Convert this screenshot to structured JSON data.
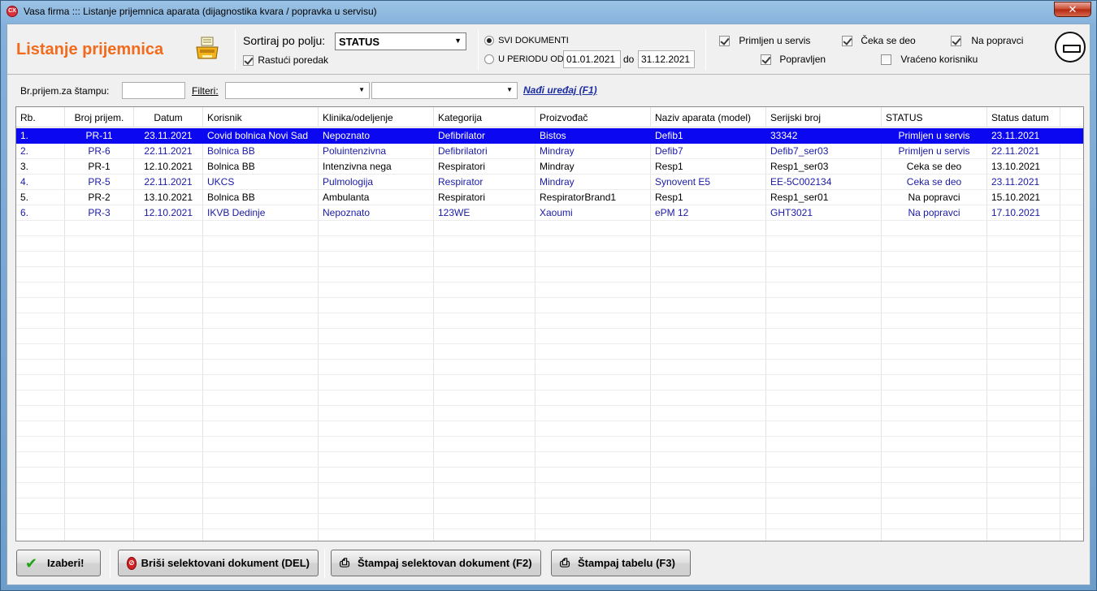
{
  "window": {
    "app_icon": "CX",
    "title": "Vasa firma ::: Listanje prijemnica aparata (dijagnostika kvara / popravka u servisu)",
    "close_label": "✕"
  },
  "header": {
    "page_title": "Listanje prijemnica",
    "sort_label": "Sortiraj po polju:",
    "sort_value": "STATUS",
    "ascending_label": "Rastući poredak",
    "ascending_checked": true,
    "all_docs_label": "SVI DOKUMENTI",
    "period_label": "U PERIODU OD:",
    "date_from": "01.01.2021",
    "date_to_label": "do",
    "date_to": "31.12.2021",
    "status_filters": {
      "primljen": "Primljen u servis",
      "ceka": "Čeka se deo",
      "na_popravci": "Na popravci",
      "popravljen": "Popravljen",
      "vraceno": "Vraćeno korisniku"
    }
  },
  "filter_row": {
    "print_label": "Br.prijem.za štampu:",
    "filters_label": "Filteri:",
    "find_link": "Nađi uređaj (F1)"
  },
  "table": {
    "columns": [
      "Rb.",
      "Broj prijem.",
      "Datum",
      "Korisnik",
      "Klinika/odeljenje",
      "Kategorija",
      "Proizvođač",
      "Naziv aparata (model)",
      "Serijski broj",
      "STATUS",
      "Status datum"
    ],
    "rows": [
      [
        "1.",
        "PR-11",
        "23.11.2021",
        "Covid bolnica Novi Sad",
        "Nepoznato",
        "Defibrilator",
        "Bistos",
        "Defib1",
        "33342",
        "Primljen u servis",
        "23.11.2021"
      ],
      [
        "2.",
        "PR-6",
        "22.11.2021",
        "Bolnica BB",
        "Poluintenzivna",
        "Defibrilatori",
        "Mindray",
        "Defib7",
        "Defib7_ser03",
        "Primljen u servis",
        "22.11.2021"
      ],
      [
        "3.",
        "PR-1",
        "12.10.2021",
        "Bolnica BB",
        "Intenzivna nega",
        "Respiratori",
        "Mindray",
        "Resp1",
        "Resp1_ser03",
        "Ceka se deo",
        "13.10.2021"
      ],
      [
        "4.",
        "PR-5",
        "22.11.2021",
        "UKCS",
        "Pulmologija",
        "Respirator",
        "Mindray",
        "Synovent E5",
        "EE-5C002134",
        "Ceka se deo",
        "23.11.2021"
      ],
      [
        "5.",
        "PR-2",
        "13.10.2021",
        "Bolnica BB",
        "Ambulanta",
        "Respiratori",
        "RespiratorBrand1",
        "Resp1",
        "Resp1_ser01",
        "Na popravci",
        "15.10.2021"
      ],
      [
        "6.",
        "PR-3",
        "12.10.2021",
        "IKVB Dedinje",
        "Nepoznato",
        "123WE",
        "Xaoumi",
        "ePM 12",
        "GHT3021",
        "Na popravci",
        "17.10.2021"
      ]
    ]
  },
  "buttons": {
    "choose": "Izaberi!",
    "delete": "Briši selektovani dokument (DEL)",
    "print_doc": "Štampaj selektovan dokument (F2)",
    "print_table": "Štampaj tabelu (F3)"
  }
}
